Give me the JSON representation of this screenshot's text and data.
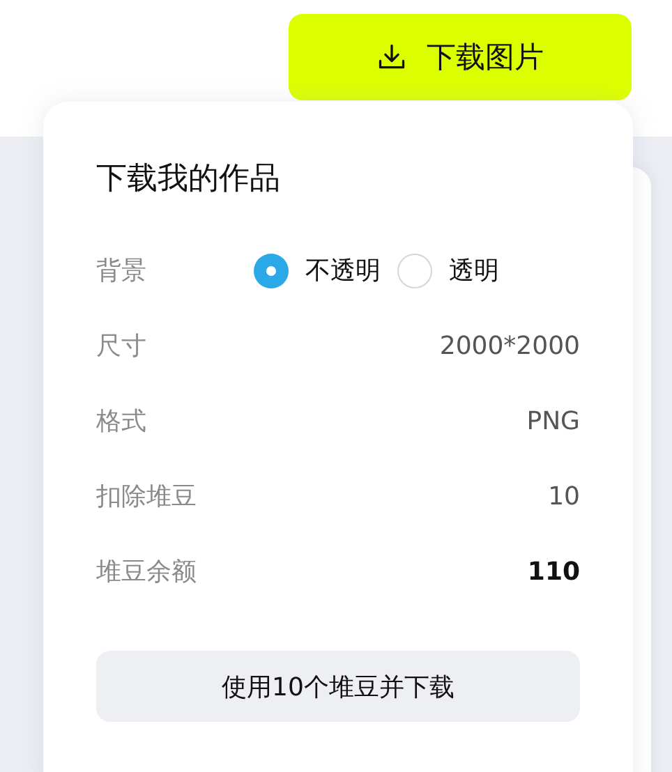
{
  "download_button": {
    "label": "下载图片"
  },
  "panel": {
    "title": "下载我的作品",
    "background": {
      "label": "背景",
      "options": [
        {
          "label": "不透明",
          "selected": true
        },
        {
          "label": "透明",
          "selected": false
        }
      ]
    },
    "rows": [
      {
        "label": "尺寸",
        "value": "2000*2000",
        "strong": false
      },
      {
        "label": "格式",
        "value": "PNG",
        "strong": false
      },
      {
        "label": "扣除堆豆",
        "value": "10",
        "strong": false
      },
      {
        "label": "堆豆余额",
        "value": "110",
        "strong": true
      }
    ],
    "confirm_button": {
      "label": "使用10个堆豆并下载"
    }
  }
}
